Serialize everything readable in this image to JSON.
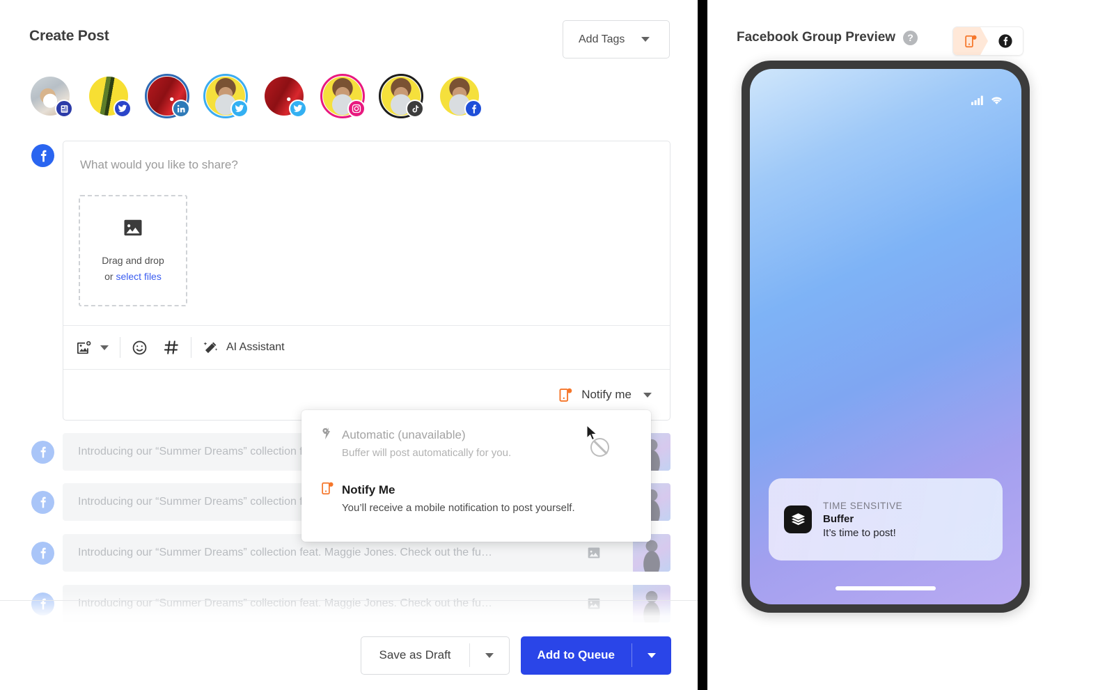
{
  "window": {
    "close_label": "×"
  },
  "left": {
    "title": "Create Post",
    "add_tags": {
      "label": "Add Tags"
    },
    "accounts": [
      {
        "name": "mastodon-account",
        "platform": "mastodon",
        "ring": "none"
      },
      {
        "name": "twitter-account-1",
        "platform": "twitter",
        "ring": "none"
      },
      {
        "name": "linkedin-account",
        "platform": "linkedin",
        "ring": "#2e6ab3"
      },
      {
        "name": "twitter-account-2",
        "platform": "twitter",
        "ring": "#3cacf0"
      },
      {
        "name": "twitter-account-3",
        "platform": "twitter",
        "ring": "none"
      },
      {
        "name": "instagram-account",
        "platform": "instagram",
        "ring": "#e8197f"
      },
      {
        "name": "tiktok-account",
        "platform": "tiktok",
        "ring": "#1c1c1c"
      },
      {
        "name": "facebook-account",
        "platform": "facebook",
        "ring": "none"
      }
    ],
    "composer": {
      "placeholder": "What would you like to share?",
      "dropzone_line1": "Drag and drop",
      "dropzone_or": "or ",
      "dropzone_link": "select files"
    },
    "toolbar": {
      "ai_label": "AI Assistant"
    },
    "notify": {
      "label": "Notify me"
    },
    "menu": {
      "automatic": {
        "title": "Automatic (unavailable)",
        "subtitle": "Buffer will post automatically for you."
      },
      "notify_me": {
        "title": "Notify Me",
        "subtitle": "You’ll receive a mobile notification to post yourself."
      }
    },
    "queue_rows": [
      {
        "text": "Introducing our “Summer Dreams” collection feat. Maggie Jones. Check out the fu…"
      },
      {
        "text": "Introducing our “Summer Dreams” collection feat. Maggie Jones. Check out the fu…"
      },
      {
        "text": "Introducing our “Summer Dreams” collection feat. Maggie Jones. Check out the fu…"
      },
      {
        "text": "Introducing our “Summer Dreams” collection feat. Maggie Jones. Check out the fu…"
      }
    ],
    "footer": {
      "save_draft": "Save as Draft",
      "add_to_queue": "Add to Queue"
    }
  },
  "right": {
    "title": "Facebook Group Preview",
    "help": "?",
    "toggle": {
      "active": "notify-tab",
      "options": [
        "notify-tab",
        "facebook-tab"
      ]
    },
    "phone": {
      "notification": {
        "kicker": "TIME SENSITIVE",
        "app": "Buffer",
        "message": "It’s time to post!"
      }
    }
  },
  "colors": {
    "accent_blue": "#2a45e8",
    "facebook_blue": "#2a65f0",
    "notify_orange": "#f5762a",
    "link_blue": "#3a5cf0"
  }
}
